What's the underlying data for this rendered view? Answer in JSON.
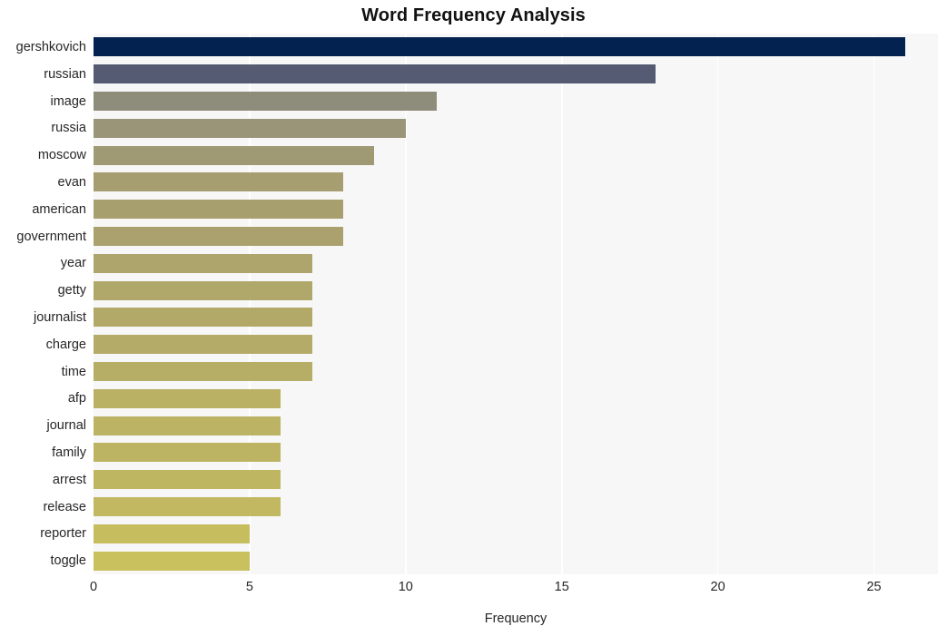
{
  "chart_data": {
    "type": "bar",
    "orientation": "horizontal",
    "title": "Word Frequency Analysis",
    "xlabel": "Frequency",
    "ylabel": "",
    "xlim": [
      0,
      27.05
    ],
    "xticks": [
      0,
      5,
      10,
      15,
      20,
      25
    ],
    "xtick_labels": [
      "0",
      "5",
      "10",
      "15",
      "20",
      "25"
    ],
    "grid": "vertical-white",
    "legend": null,
    "background": "#f7f7f7",
    "categories": [
      "gershkovich",
      "russian",
      "image",
      "russia",
      "moscow",
      "evan",
      "american",
      "government",
      "year",
      "getty",
      "journalist",
      "charge",
      "time",
      "afp",
      "journal",
      "family",
      "arrest",
      "release",
      "reporter",
      "toggle"
    ],
    "values": [
      26,
      18,
      11,
      10,
      9,
      8,
      8,
      8,
      7,
      7,
      7,
      7,
      7,
      6,
      6,
      6,
      6,
      6,
      5,
      5
    ],
    "bar_colors": [
      "#04224f",
      "#545b72",
      "#8e8c7a",
      "#9a9579",
      "#a09a74",
      "#a69e71",
      "#a89f6f",
      "#aaa16e",
      "#aea56c",
      "#b0a76a",
      "#b2a969",
      "#b4ab68",
      "#b6ad67",
      "#bab165",
      "#bcb364",
      "#bdb463",
      "#bfb662",
      "#c1b861",
      "#c6bd5f",
      "#c9c05e"
    ]
  }
}
